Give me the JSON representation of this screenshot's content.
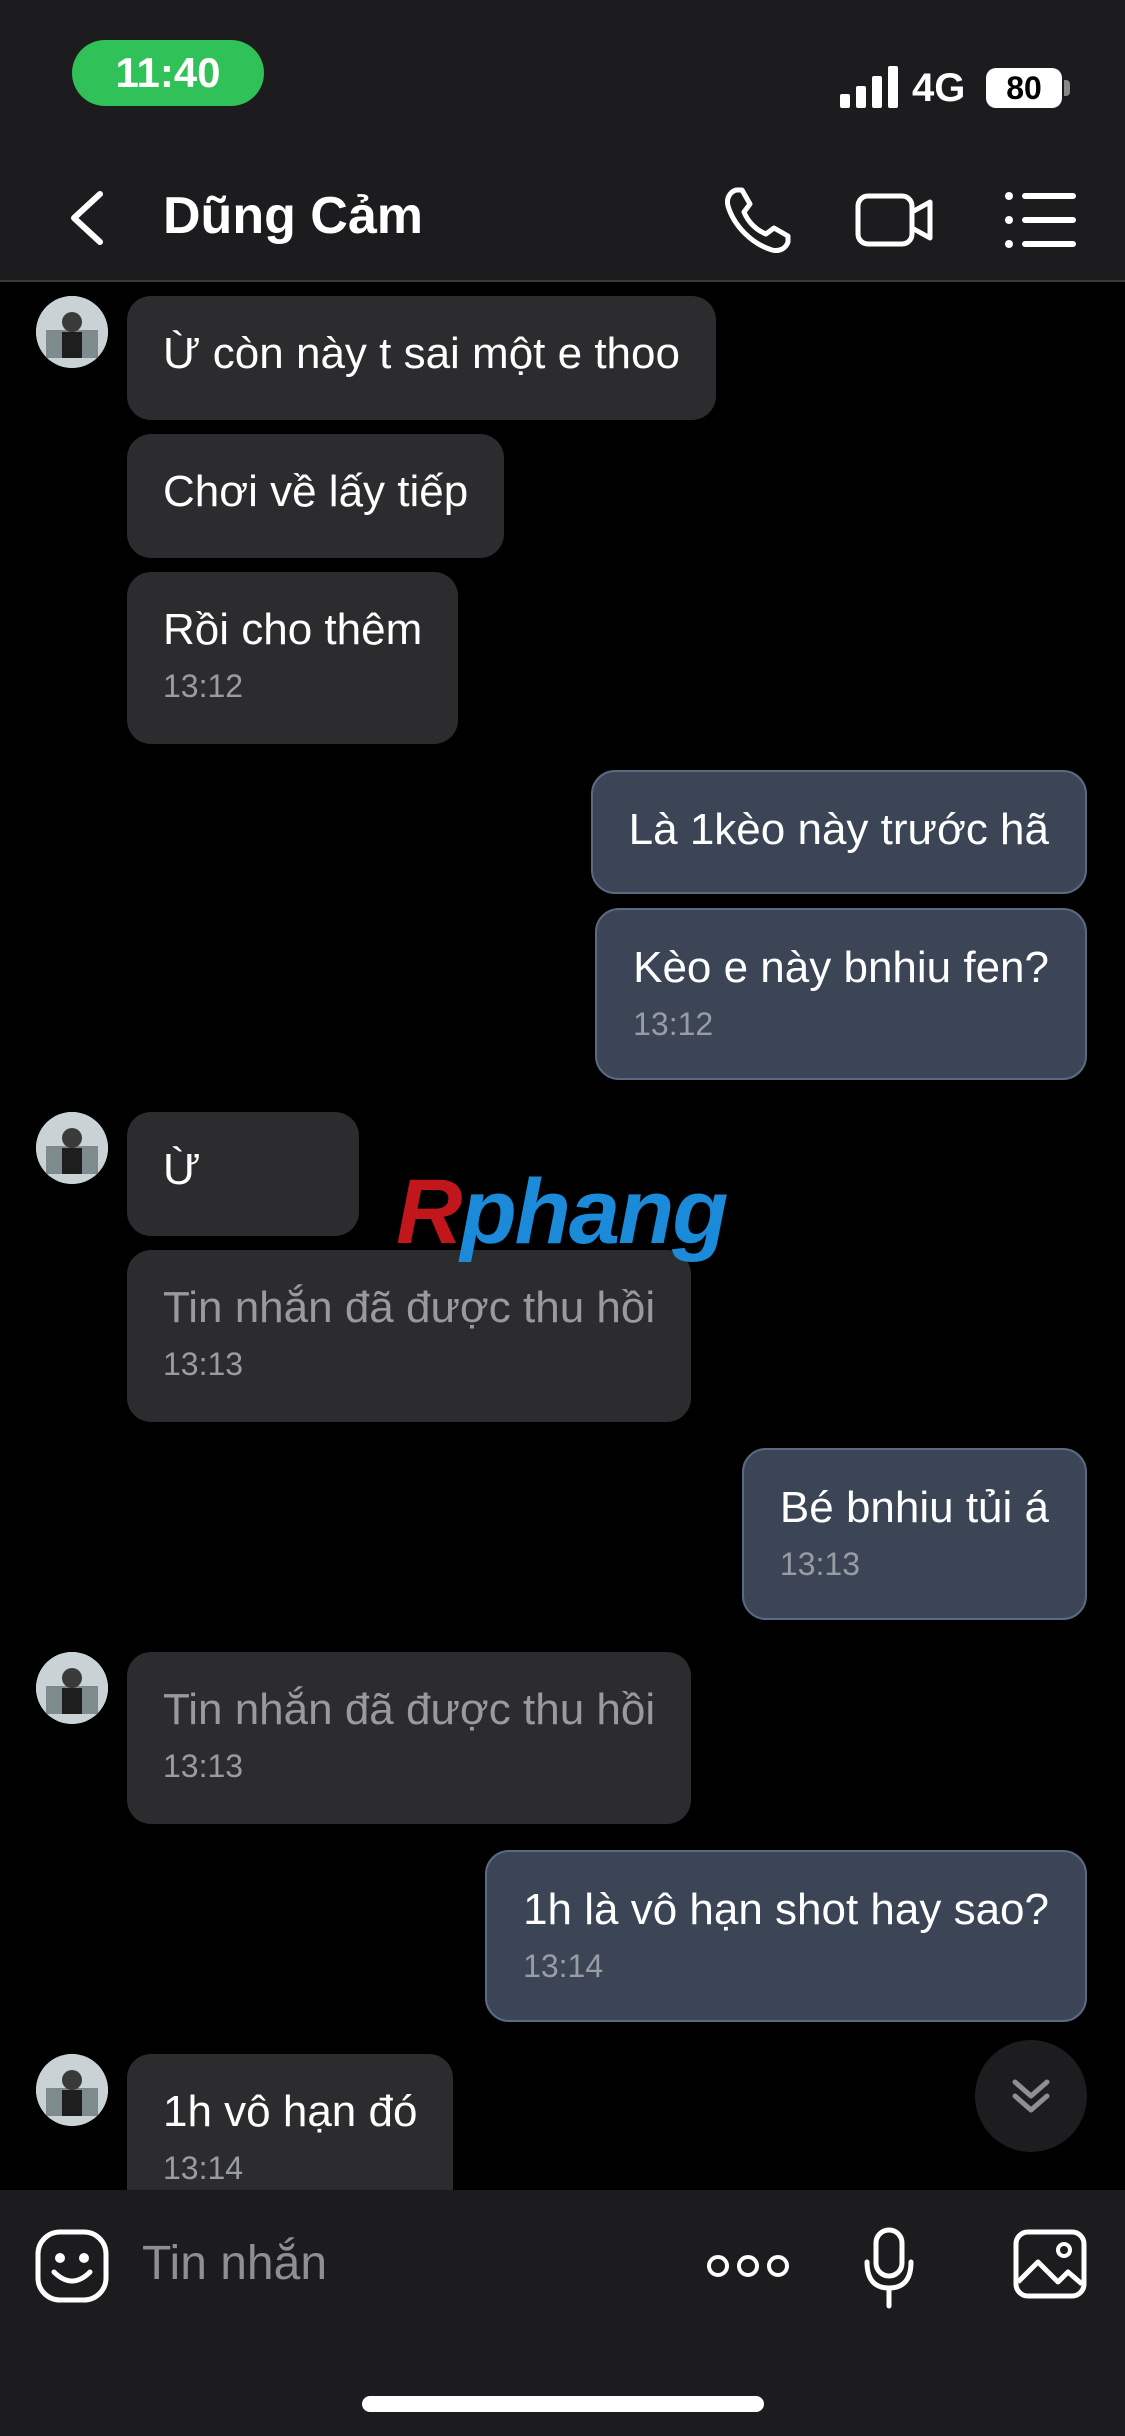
{
  "status_bar": {
    "time": "11:40",
    "network": "4G",
    "battery": "80"
  },
  "header": {
    "contact_name": "Dũng Cảm"
  },
  "messages": [
    {
      "side": "in",
      "text": "Ừ còn này t sai một e thoo",
      "time": ""
    },
    {
      "side": "in",
      "text": "Chơi về lấy tiếp",
      "time": ""
    },
    {
      "side": "in",
      "text": "Rồi cho thêm",
      "time": "13:12"
    },
    {
      "side": "out",
      "text": "Là 1kèo này trước hã",
      "time": ""
    },
    {
      "side": "out",
      "text": "Kèo e này bnhiu fen?",
      "time": "13:12"
    },
    {
      "side": "in",
      "text": "Ừ",
      "time": ""
    },
    {
      "side": "in",
      "text": "Tin nhắn đã được thu hồi",
      "time": "13:13",
      "recalled": true
    },
    {
      "side": "out",
      "text": "Bé bnhiu tủi á",
      "time": "13:13"
    },
    {
      "side": "in",
      "text": "Tin nhắn đã được thu hồi",
      "time": "13:13",
      "recalled": true
    },
    {
      "side": "out",
      "text": "1h là vô hạn shot hay sao?",
      "time": "13:14"
    },
    {
      "side": "in",
      "text": "1h vô hạn đó",
      "time": "13:14"
    }
  ],
  "watermark": {
    "r": "R",
    "rest": "phang"
  },
  "input_bar": {
    "placeholder": "Tin nhắn"
  },
  "icons": {
    "back": "chevron-left-icon",
    "call": "phone-icon",
    "video": "video-camera-icon",
    "menu": "list-menu-icon",
    "emoji": "emoji-icon",
    "more": "more-dots-icon",
    "mic": "microphone-icon",
    "image": "image-icon",
    "scroll": "chevron-double-down-icon"
  },
  "colors": {
    "incoming_bubble": "#2c2c2e",
    "outgoing_bubble": "#3b4556",
    "time_pill": "#30c158",
    "background": "#000000"
  }
}
